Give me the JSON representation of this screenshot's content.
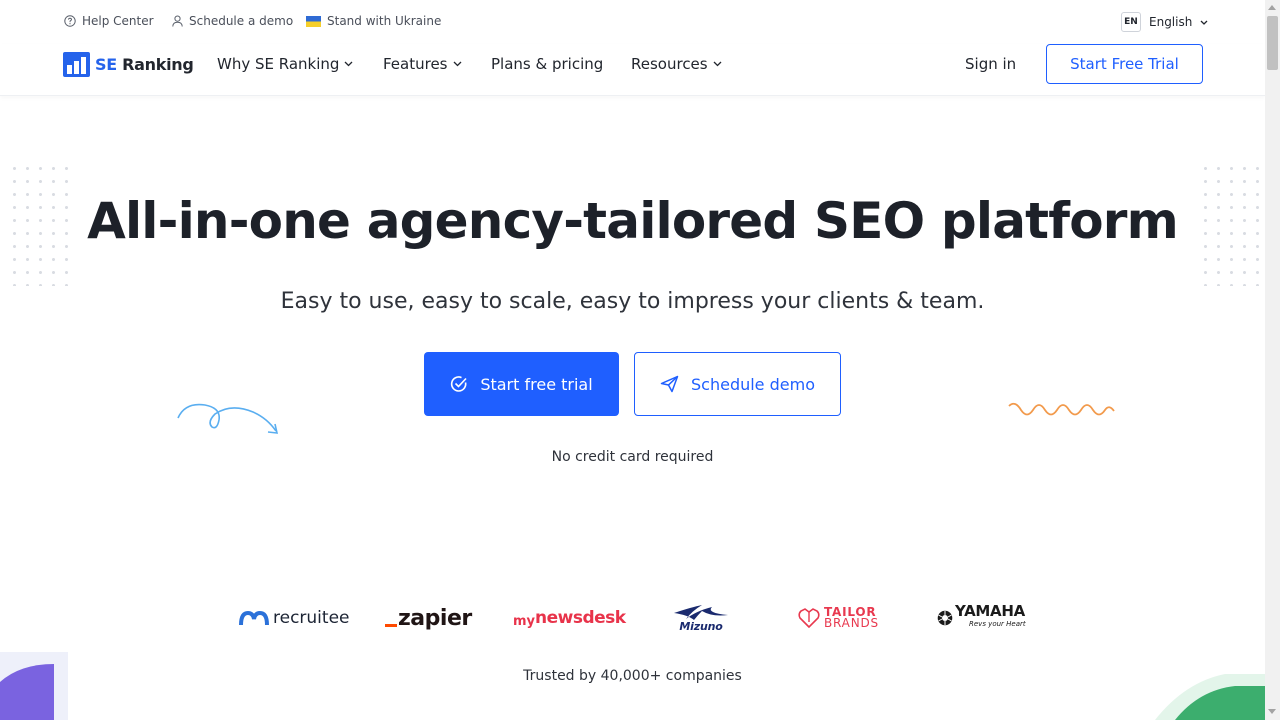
{
  "topbar": {
    "help": "Help Center",
    "demo": "Schedule a demo",
    "ukraine": "Stand with Ukraine",
    "lang_code": "EN",
    "lang_label": "English"
  },
  "nav": {
    "logo_se": "SE",
    "logo_ranking": "Ranking",
    "why": "Why SE Ranking",
    "features": "Features",
    "pricing": "Plans & pricing",
    "resources": "Resources",
    "signin": "Sign in",
    "trial": "Start Free Trial"
  },
  "hero": {
    "title": "All-in-one agency-tailored SEO platform",
    "subtitle": "Easy to use, easy to scale, easy to impress your clients & team.",
    "primary_cta": "Start free trial",
    "secondary_cta": "Schedule demo",
    "note": "No credit card required"
  },
  "brands": {
    "recruitee": "recruitee",
    "zapier": "zapier",
    "mynewsdesk_my": "my",
    "mynewsdesk_rest": "newsdesk",
    "mizuno": "Mizuno",
    "tailor_1": "TAILOR",
    "tailor_2": "BRANDS",
    "yamaha": "YAMAHA",
    "yamaha_tag": "Revs your Heart",
    "trusted": "Trusted by 40,000+ companies"
  },
  "colors": {
    "accent": "#1f5fff",
    "title": "#1d2129",
    "ukraine_blue": "#2f6bd4",
    "ukraine_yellow": "#f6cf2a"
  }
}
